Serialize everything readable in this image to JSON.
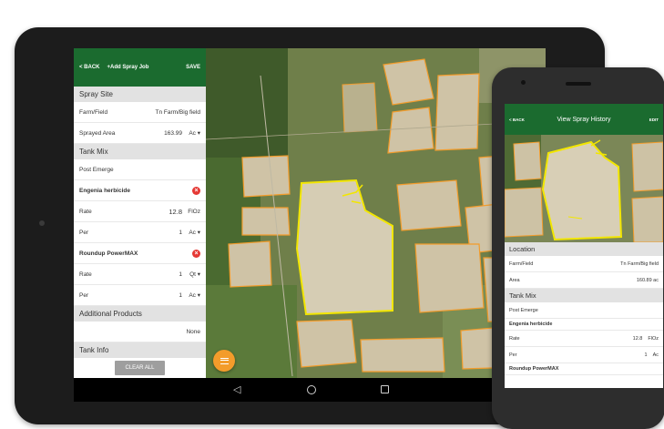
{
  "tablet": {
    "appbar": {
      "back_label": "< BACK",
      "title": "+Add Spray Job",
      "save_label": "SAVE"
    },
    "spray_site": {
      "header": "Spray Site",
      "farm_field": {
        "label": "Farm/Field",
        "value": "Tn Farm/Big field"
      },
      "sprayed_area": {
        "label": "Sprayed Area",
        "value": "163.99",
        "unit": "Ac ▾"
      }
    },
    "tank_mix": {
      "header": "Tank Mix",
      "timing": "Post Emerge",
      "products": [
        {
          "name": "Engenia herbicide",
          "rate_label": "Rate",
          "rate_value": "12.8",
          "rate_unit": "FlOz",
          "per_label": "Per",
          "per_value": "1",
          "per_unit": "Ac ▾"
        },
        {
          "name": "Roundup PowerMAX",
          "rate_label": "Rate",
          "rate_value": "1",
          "rate_unit": "Qt ▾",
          "per_label": "Per",
          "per_value": "1",
          "per_unit": "Ac ▾"
        }
      ]
    },
    "additional_products": {
      "header": "Additional Products",
      "value": "None"
    },
    "tank_info": {
      "header": "Tank Info"
    },
    "clear_all_label": "CLEAR ALL"
  },
  "phone": {
    "appbar": {
      "back_label": "< BACK",
      "title": "View Spray History",
      "edit_label": "EDIT"
    },
    "location": {
      "header": "Location",
      "farm_field": {
        "label": "Farm/Field",
        "value": "Tn Farm/Big field"
      },
      "area": {
        "label": "Area",
        "value": "160.89 ac"
      }
    },
    "tank_mix": {
      "header": "Tank Mix",
      "timing": "Post Emerge",
      "product1": {
        "name": "Engenia herbicide",
        "rate_label": "Rate",
        "rate_value": "12.8",
        "rate_unit": "FlOz",
        "per_label": "Per",
        "per_value": "1",
        "per_unit": "Ac"
      },
      "product2": {
        "name": "Roundup PowerMAX"
      }
    }
  },
  "colors": {
    "appbar_green": "#1b6b2f",
    "field_boundary_orange": "#f39c2b",
    "selected_field_yellow": "#f2e600",
    "remove_red": "#e53935",
    "fab_orange": "#f39c2b"
  },
  "icons": {
    "remove": "x-circle-icon",
    "fab": "menu-icon",
    "nav": [
      "back-triangle-icon",
      "home-circle-icon",
      "recents-square-icon"
    ]
  }
}
